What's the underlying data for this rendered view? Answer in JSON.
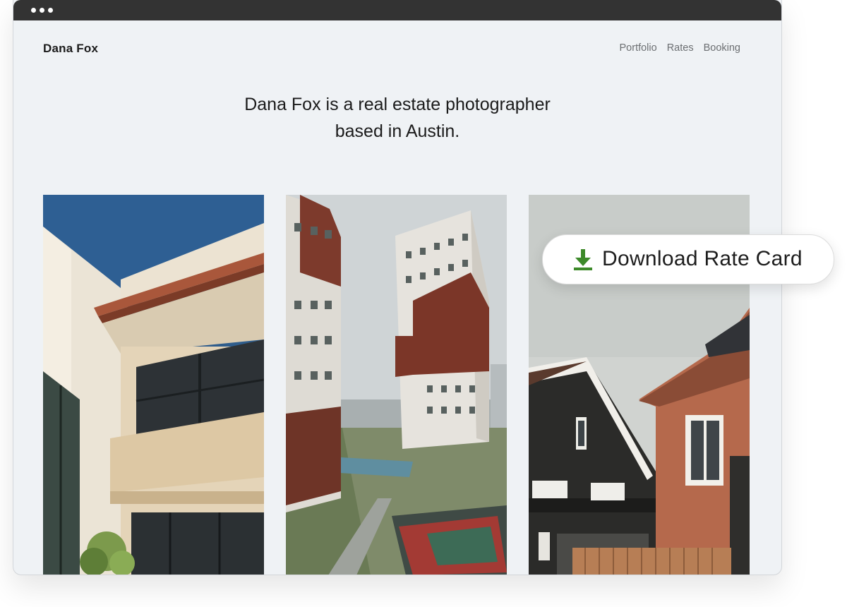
{
  "browser": {
    "controls": [
      "dot",
      "dot",
      "dot"
    ]
  },
  "header": {
    "brand": "Dana Fox",
    "nav": [
      {
        "label": "Portfolio"
      },
      {
        "label": "Rates"
      },
      {
        "label": "Booking"
      }
    ]
  },
  "hero": {
    "line1": "Dana Fox is a real estate photographer",
    "line2": "based in Austin."
  },
  "gallery": [
    {
      "subject": "modern beige house with tiled roof eave and large windows"
    },
    {
      "subject": "high-rise apartment towers with pool and basketball court"
    },
    {
      "subject": "dark wooden house and red brick house with pitched roofs"
    }
  ],
  "cta": {
    "label": "Download Rate Card",
    "icon": "download-icon",
    "icon_color": "#3d8a2a"
  },
  "colors": {
    "page_bg": "#eff2f5",
    "titlebar": "#333333",
    "text": "#1b1b1b",
    "nav_text": "#6c6f72"
  }
}
